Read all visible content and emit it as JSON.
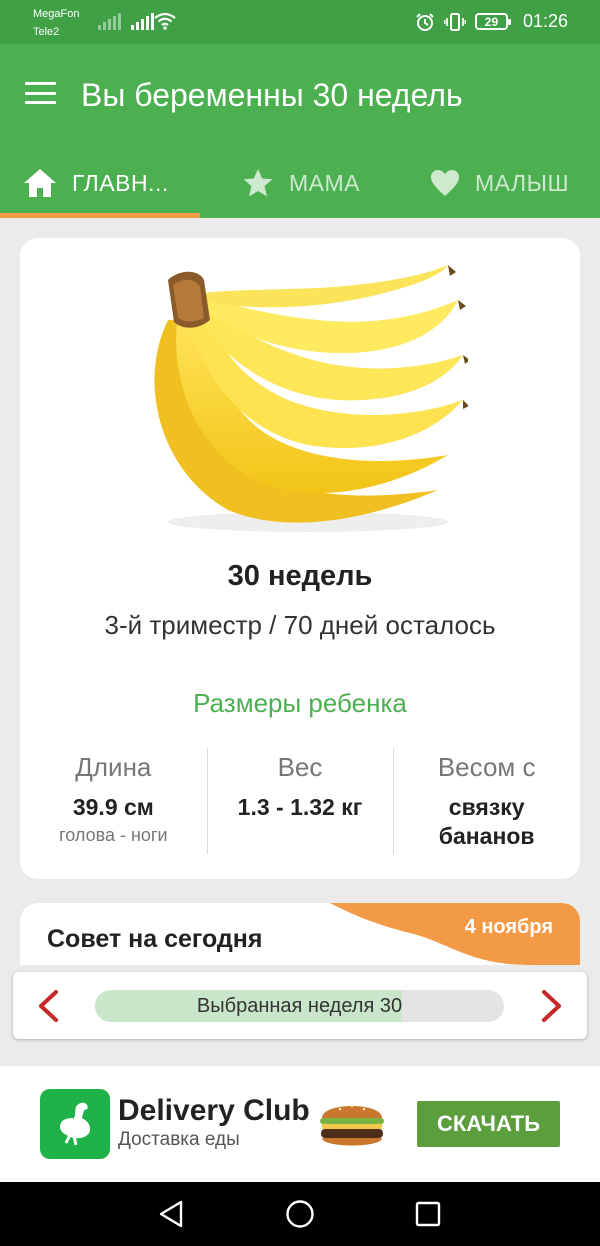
{
  "status_bar": {
    "carrier1": "MegaFon",
    "carrier2": "Tele2",
    "battery": "29",
    "time": "01:26"
  },
  "app_bar": {
    "title": "Вы беременны 30 недель"
  },
  "tabs": [
    {
      "label": "ГЛАВН...",
      "icon": "home-icon",
      "active": true
    },
    {
      "label": "МАМА",
      "icon": "star-icon",
      "active": false
    },
    {
      "label": "МАЛЫШ",
      "icon": "heart-icon",
      "active": false
    }
  ],
  "week_card": {
    "image": "bananas-bunch",
    "weeks": "30 недель",
    "trimester": "3-й триместр / 70 дней осталось",
    "sizes_title": "Размеры ребенка",
    "length": {
      "label": "Длина",
      "value": "39.9 см",
      "sub": "голова - ноги"
    },
    "weight": {
      "label": "Вес",
      "value": "1.3 - 1.32 кг"
    },
    "compare": {
      "label": "Весом с",
      "value_line1": "связку",
      "value_line2": "бананов"
    }
  },
  "tip": {
    "title": "Совет на сегодня",
    "date": "4 ноября"
  },
  "week_nav": {
    "label": "Выбранная неделя 30",
    "progress": 0.75
  },
  "ad": {
    "brand": "Delivery Club",
    "subtitle": "Доставка еды",
    "button": "СКАЧАТЬ"
  },
  "colors": {
    "primary": "#4caf50",
    "status_bar": "#3fa045",
    "accent_orange": "#f29a45",
    "arrow_red": "#c62828",
    "ad_button": "#5c9e3d",
    "ad_logo": "#1fb248"
  }
}
